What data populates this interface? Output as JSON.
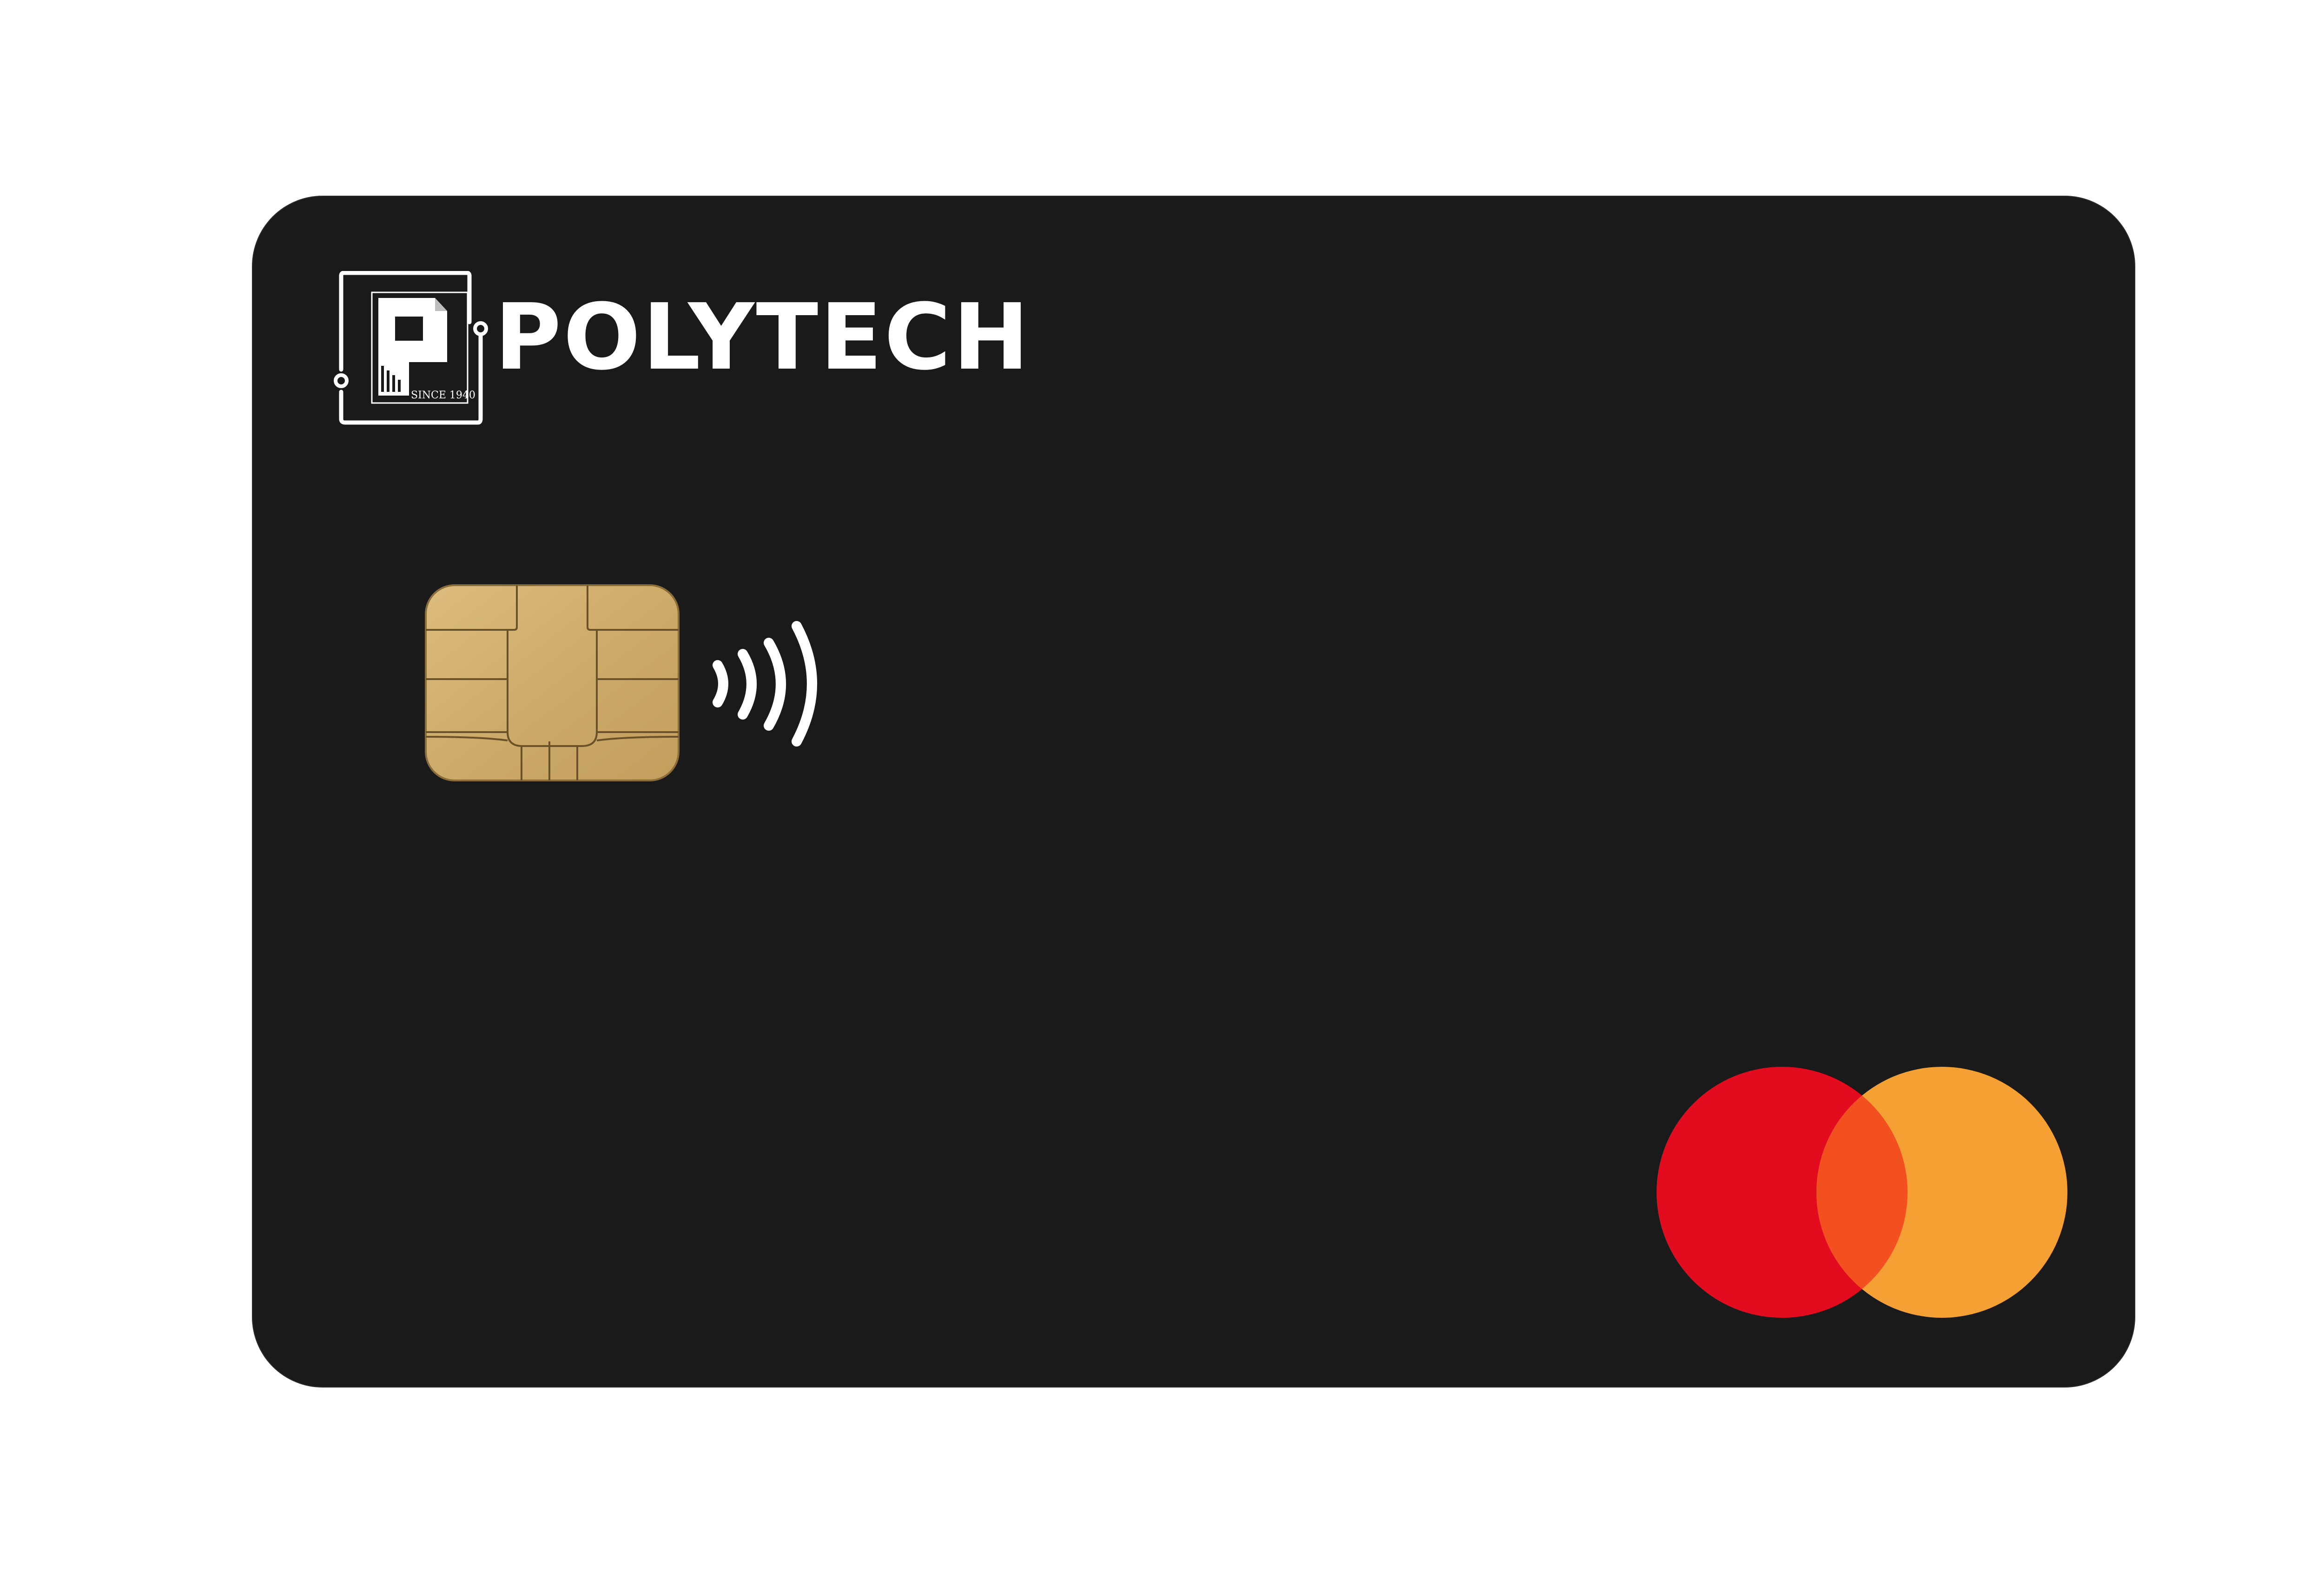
{
  "card": {
    "brand_name": "POLYTECH",
    "logo_tagline": "SINCE 1940",
    "logo_letter": "P",
    "background_color": "#1a1a1a"
  },
  "icons": {
    "logo": "polytech-logo-icon",
    "chip": "emv-chip-icon",
    "contactless": "contactless-icon",
    "network": "mastercard-logo-icon"
  },
  "colors": {
    "chip_gold": "#cfae6e",
    "network_red": "#e30b1e",
    "network_orange": "#f4a033",
    "network_overlap": "#f2501f",
    "text": "#ffffff"
  }
}
